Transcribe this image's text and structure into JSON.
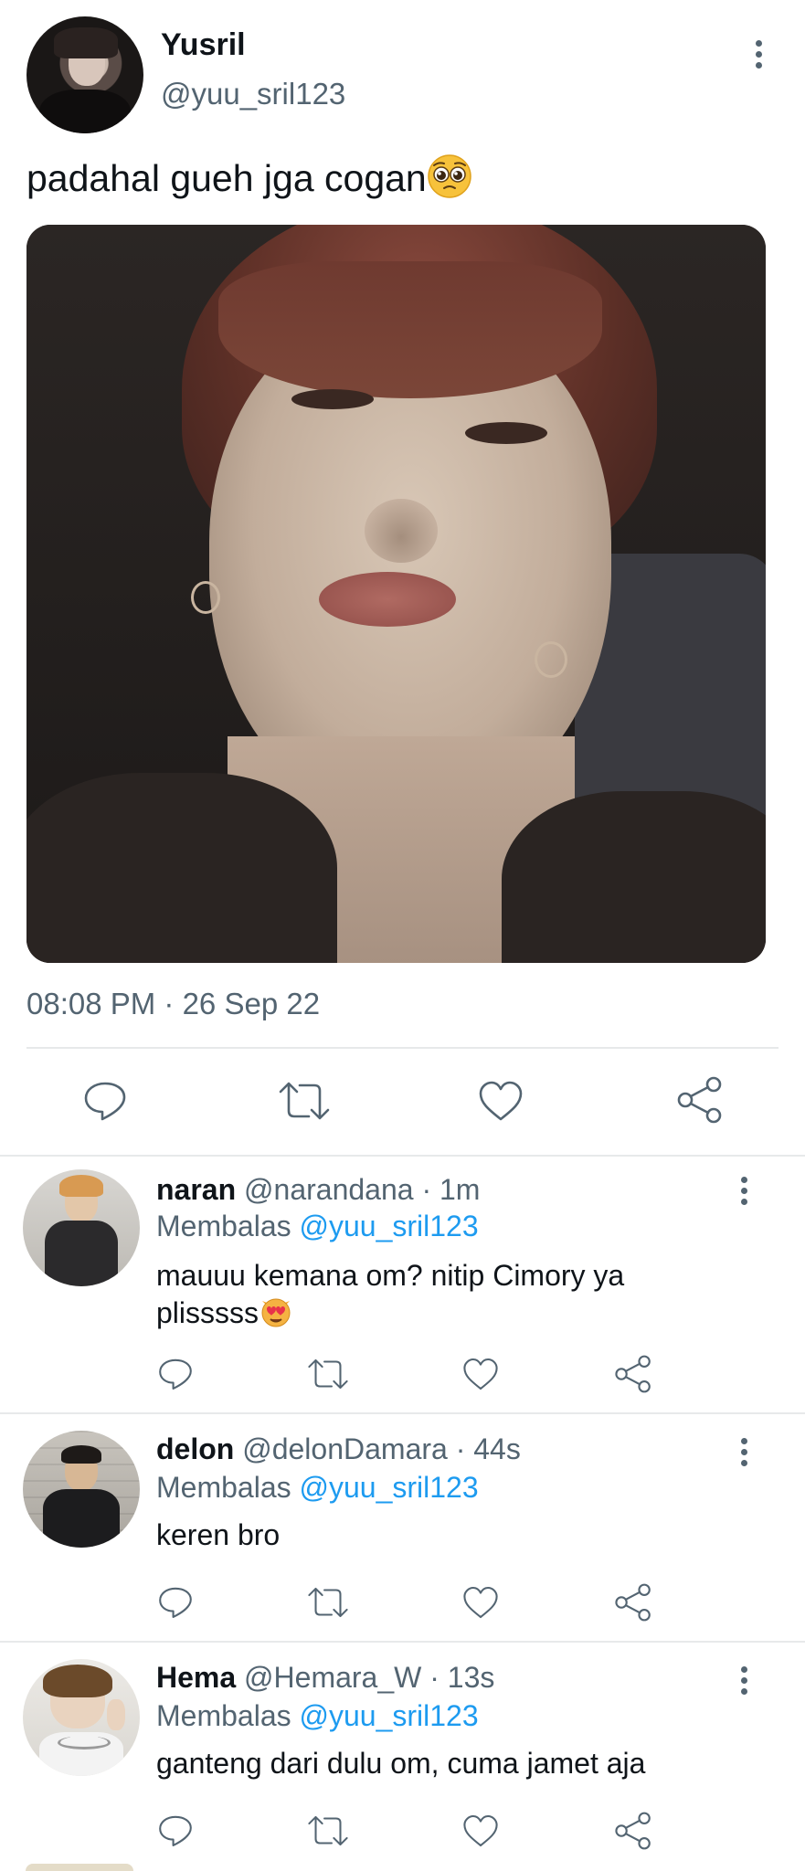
{
  "tweet": {
    "author_name": "Yusril",
    "author_handle": "@yuu_sril123",
    "text": "padahal gueh jga cogan",
    "emoji": "pleading-face",
    "timestamp": "08:08 PM · 26 Sep 22",
    "actions": [
      "reply",
      "retweet",
      "like",
      "share"
    ]
  },
  "replies": [
    {
      "name": "naran",
      "handle": "@narandana",
      "time": "· 1m",
      "replying_label": "Membalas",
      "replying_to": "@yuu_sril123",
      "text_line1": "mauuu kemana om? nitip Cimory ya",
      "text_line2": "plisssss",
      "emoji": "heart-eyes-cat"
    },
    {
      "name": "delon",
      "handle": "@delonDamara",
      "time": "· 44s",
      "replying_label": "Membalas",
      "replying_to": "@yuu_sril123",
      "text_line1": "keren bro"
    },
    {
      "name": "Hema",
      "handle": "@Hemara_W",
      "time": "· 13s",
      "replying_label": "Membalas",
      "replying_to": "@yuu_sril123",
      "text_line1": "ganteng dari dulu om, cuma jamet aja"
    }
  ],
  "colors": {
    "link": "#1d9bf0",
    "muted": "#536471",
    "divider": "#e7e9ea"
  }
}
